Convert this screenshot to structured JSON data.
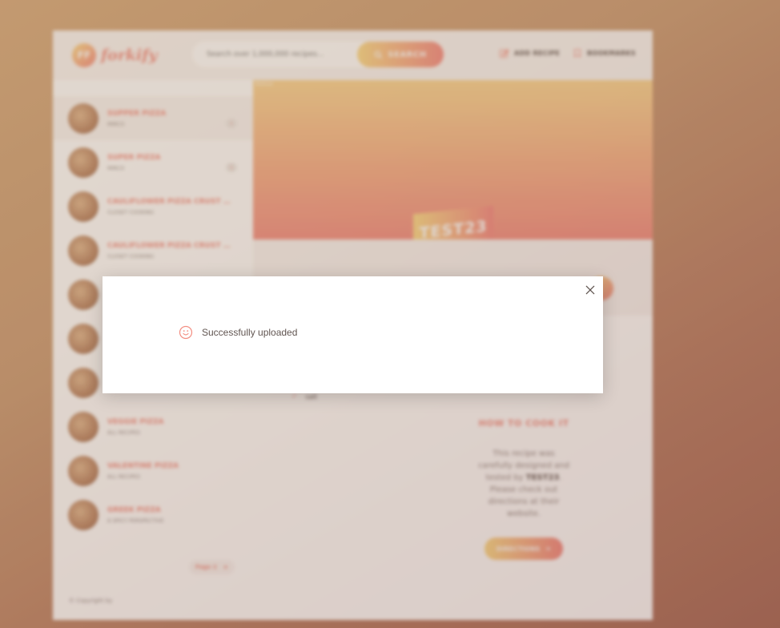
{
  "header": {
    "logo_badge": "FF",
    "logo_text": "forkify",
    "search_placeholder": "Search over 1,000,000 recipes...",
    "search_label": "SEARCH",
    "add_recipe_label": "ADD RECIPE",
    "bookmarks_label": "BOOKMARKS"
  },
  "sidebar": {
    "results": [
      {
        "title": "SUPPER PIZZA",
        "publisher": "MIRCO",
        "user": "1"
      },
      {
        "title": "SUPER PIZZA",
        "publisher": "MIRCO",
        "user": "1"
      },
      {
        "title": "CAULIFLOWER PIZZA CRUST (WITH BASIL...",
        "publisher": "CLOSET COOKING",
        "user": ""
      },
      {
        "title": "CAULIFLOWER PIZZA CRUST (WITH BASIL...",
        "publisher": "CLOSET COOKING",
        "user": ""
      },
      {
        "title": "",
        "publisher": "",
        "user": ""
      },
      {
        "title": "",
        "publisher": "",
        "user": ""
      },
      {
        "title": "",
        "publisher": "",
        "user": ""
      },
      {
        "title": "VEGGIE PIZZA",
        "publisher": "ALL RECIPES",
        "user": ""
      },
      {
        "title": "VALENTINE PIZZA",
        "publisher": "ALL RECIPES",
        "user": ""
      },
      {
        "title": "GREEK PIZZA",
        "publisher": "A SPICY PERSPECTIVE",
        "user": ""
      }
    ],
    "pagination": "Page 2",
    "copyright": "© Copyright by"
  },
  "recipe": {
    "image_alt": "TEST23",
    "title": "TEST23",
    "ingredient": "salt",
    "directions_heading": "HOW TO COOK IT",
    "directions_text_pre": "This recipe was carefully designed and tested by",
    "directions_publisher": "TEST23",
    "directions_text_post": ". Please check out directions at their website.",
    "directions_button": "Directions"
  },
  "modal": {
    "message": "Successfully uploaded"
  }
}
